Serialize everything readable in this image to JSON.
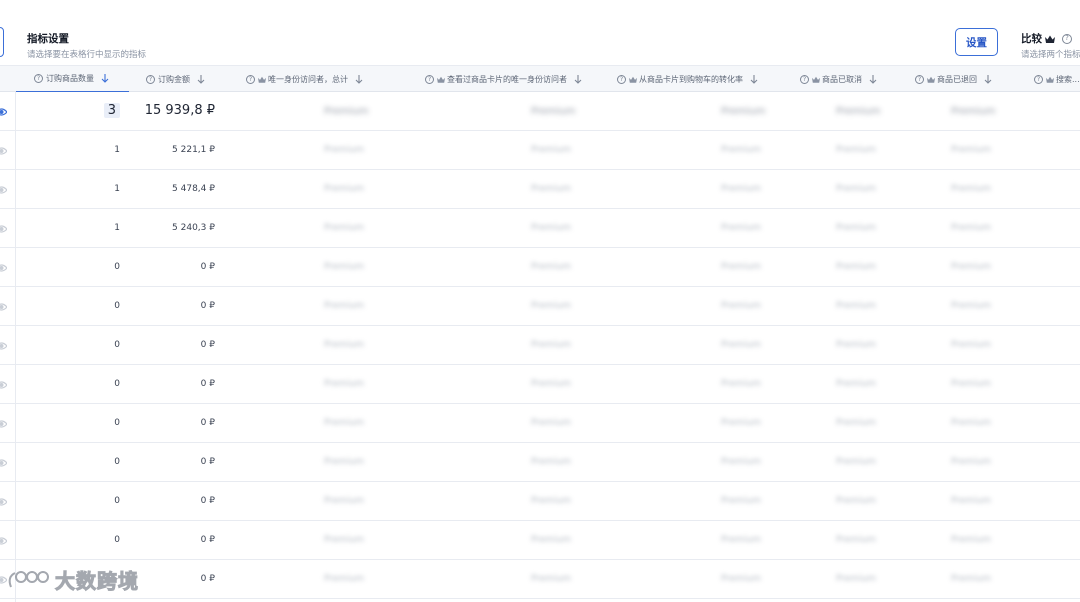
{
  "header": {
    "metrics_title": "指标设置",
    "metrics_subtitle": "请选择要在表格行中显示的指标",
    "settings_button": "设置",
    "compare_title": "比较",
    "compare_subtitle": "请选择两个指标"
  },
  "columns": [
    {
      "label": "订购商品数量",
      "premium": false,
      "active": true
    },
    {
      "label": "订购金额",
      "premium": false,
      "active": false
    },
    {
      "label": "唯一身份访问者，总计",
      "premium": true,
      "active": false
    },
    {
      "label": "查看过商品卡片的唯一身份访问者",
      "premium": true,
      "active": false
    },
    {
      "label": "从商品卡片到购物车的转化率",
      "premium": true,
      "active": false
    },
    {
      "label": "商品已取消",
      "premium": true,
      "active": false
    },
    {
      "label": "商品已退回",
      "premium": true,
      "active": false
    },
    {
      "label": "搜索...",
      "premium": true,
      "active": false
    }
  ],
  "rows": [
    {
      "qty": "3",
      "amount": "15 939,8 ₽",
      "total": true
    },
    {
      "qty": "1",
      "amount": "5 221,1 ₽"
    },
    {
      "qty": "1",
      "amount": "5 478,4 ₽"
    },
    {
      "qty": "1",
      "amount": "5 240,3 ₽"
    },
    {
      "qty": "0",
      "amount": "0 ₽"
    },
    {
      "qty": "0",
      "amount": "0 ₽"
    },
    {
      "qty": "0",
      "amount": "0 ₽"
    },
    {
      "qty": "0",
      "amount": "0 ₽"
    },
    {
      "qty": "0",
      "amount": "0 ₽"
    },
    {
      "qty": "0",
      "amount": "0 ₽"
    },
    {
      "qty": "0",
      "amount": "0 ₽"
    },
    {
      "qty": "0",
      "amount": "0 ₽"
    },
    {
      "qty": "",
      "amount": "0 ₽"
    }
  ],
  "premium_placeholder": "Premium",
  "watermark": "大数跨境",
  "colors": {
    "accent": "#3b6fd8",
    "header_bg": "#f5f7fa",
    "border": "#e8ebf1"
  }
}
